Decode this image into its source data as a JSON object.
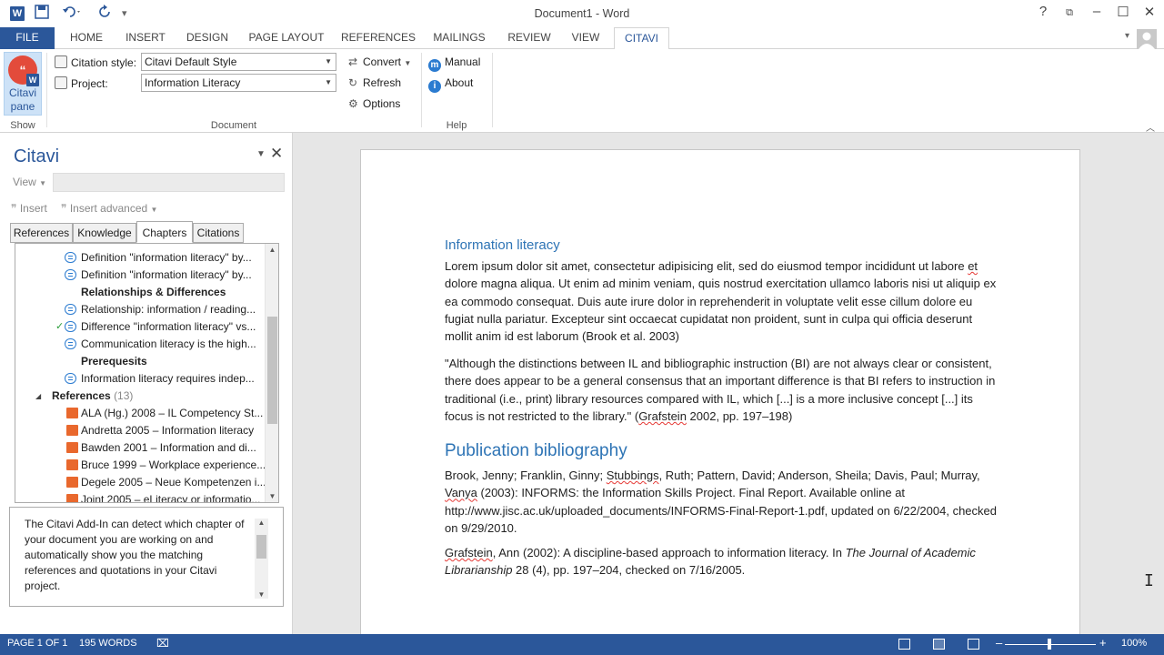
{
  "titlebar": {
    "title": "Document1 - Word",
    "logo": "W",
    "help": "?",
    "minimize": "–",
    "maximize": "☐",
    "close": "✕",
    "restore": "⧉"
  },
  "tabs": [
    {
      "label": "FILE"
    },
    {
      "label": "HOME"
    },
    {
      "label": "INSERT"
    },
    {
      "label": "DESIGN"
    },
    {
      "label": "PAGE LAYOUT"
    },
    {
      "label": "REFERENCES"
    },
    {
      "label": "MAILINGS"
    },
    {
      "label": "REVIEW"
    },
    {
      "label": "VIEW"
    },
    {
      "label": "CITAVI"
    }
  ],
  "ribbon": {
    "citavi_pane_label_1": "Citavi",
    "citavi_pane_label_2": "pane",
    "show_group": "Show",
    "citation_style_label": "Citation style:",
    "citation_style_value": "Citavi Default Style",
    "project_label": "Project:",
    "project_value": "Information Literacy",
    "convert": "Convert",
    "refresh": "Refresh",
    "options": "Options",
    "document_group": "Document",
    "manual": "Manual",
    "about": "About",
    "help_group": "Help"
  },
  "pane": {
    "title": "Citavi",
    "view_label": "View",
    "insert": "Insert",
    "insert_advanced": "Insert advanced",
    "subtabs": [
      "References",
      "Knowledge",
      "Chapters",
      "Citations"
    ],
    "active_subtab": "Chapters",
    "tree": [
      {
        "type": "quote",
        "text": "Definition \"information literacy\" by...",
        "checked": false
      },
      {
        "type": "quote",
        "text": "Definition \"information literacy\" by...",
        "checked": false
      },
      {
        "type": "heading",
        "text": "Relationships & Differences"
      },
      {
        "type": "quote",
        "text": "Relationship: information / reading...",
        "checked": false
      },
      {
        "type": "quote",
        "text": "Difference \"information literacy\" vs...",
        "checked": true
      },
      {
        "type": "quote",
        "text": "Communication literacy is the high...",
        "checked": false
      },
      {
        "type": "heading",
        "text": "Prerequesits"
      },
      {
        "type": "quote",
        "text": "Information literacy requires indep...",
        "checked": false
      },
      {
        "type": "group",
        "text": "References",
        "count": "(13)"
      },
      {
        "type": "book",
        "text": "ALA (Hg.) 2008 – IL Competency St..."
      },
      {
        "type": "book",
        "text": "Andretta 2005 – Information literacy"
      },
      {
        "type": "book",
        "text": "Bawden 2001 – Information and di..."
      },
      {
        "type": "book",
        "text": "Bruce 1999 – Workplace experience..."
      },
      {
        "type": "book",
        "text": "Degele 2005 – Neue Kompetenzen i..."
      },
      {
        "type": "book",
        "text": "Joint 2005 – eLiteracy or informatio..."
      }
    ],
    "help_text": "The Citavi Add-In can detect which chapter of your document you are working on and automatically show you the matching references and quotations in your Citavi project."
  },
  "document": {
    "heading1": "Information literacy",
    "para1_a": "Lorem ipsum dolor sit amet, consectetur adipisicing elit, sed do eiusmod tempor incididunt ut labore ",
    "para1_et": "et",
    "para1_b": " dolore magna aliqua. Ut enim ad minim veniam, quis nostrud exercitation ullamco laboris nisi ut aliquip ex ea commodo consequat. Duis aute irure dolor in reprehenderit in voluptate velit esse cillum dolore eu fugiat nulla pariatur. Excepteur sint occaecat cupidatat non proident, sunt in culpa qui officia deserunt mollit anim id est laborum (Brook et al. 2003)",
    "para2_a": "\"Although the distinctions between IL and bibliographic instruction (BI) are not always clear or consistent, there does appear to be a general consensus that an important difference is that BI refers to instruction in traditional (i.e., print) library resources compared with IL, which [...] is a more inclusive concept [...] its focus is not restricted to the library.\" (",
    "para2_grafstein": "Grafstein",
    "para2_b": " 2002, pp. 197–198)",
    "heading2": "Publication bibliography",
    "bib1_a": "Brook, Jenny; Franklin, Ginny; ",
    "bib1_stubbings": "Stubbings",
    "bib1_b": ", Ruth; Pattern, David; Anderson, Sheila; Davis, Paul; Murray, ",
    "bib1_vanya": "Vanya",
    "bib1_c": " (2003): INFORMS: the Information Skills Project. Final Report. Available online at http://www.jisc.ac.uk/uploaded_documents/INFORMS-Final-Report-1.pdf, updated on 6/22/2004, checked on 9/29/2010.",
    "bib2_grafstein": "Grafstein",
    "bib2_a": ", Ann (2002): A discipline-based approach to information literacy. In ",
    "bib2_journal": "The Journal of Academic Librarianship",
    "bib2_b": " 28 (4), pp. 197–204, checked on 7/16/2005."
  },
  "status": {
    "page": "PAGE 1 OF 1",
    "words": "195 WORDS",
    "zoom": "100%",
    "zoom_minus": "–",
    "zoom_plus": "+"
  }
}
